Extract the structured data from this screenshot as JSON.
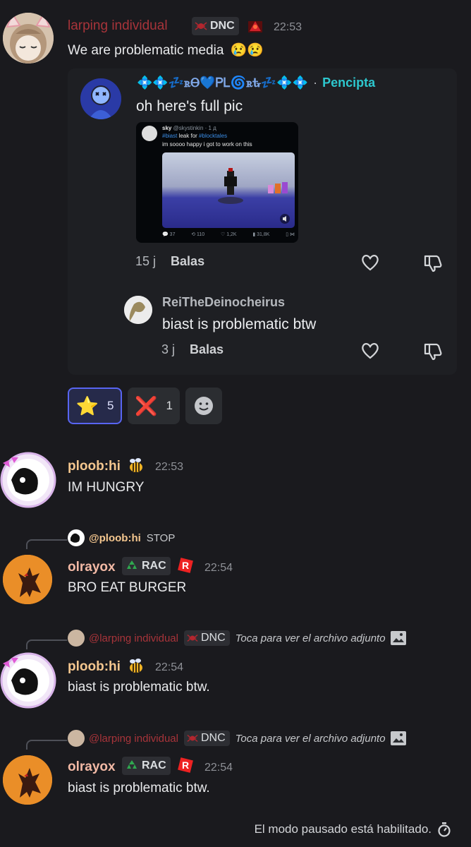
{
  "messages": [
    {
      "author": "larping individual",
      "tag": "DNC",
      "time": "22:53",
      "text": "We are problematic media",
      "emoji": "😢😢"
    },
    {
      "author": "ploob:hi",
      "time": "22:53",
      "text": "IM HUNGRY"
    },
    {
      "reply_to_name": "@ploob:hi",
      "reply_to_text": "STOP",
      "author": "olrayox",
      "tag": "RAC",
      "time": "22:54",
      "text": "BRO EAT BURGER"
    },
    {
      "reply_to_name": "@larping individual",
      "reply_to_tag": "DNC",
      "reply_to_text": "Toca para ver el archivo adjunto",
      "author": "ploob:hi",
      "time": "22:54",
      "text": "biast is problematic btw."
    },
    {
      "reply_to_name": "@larping individual",
      "reply_to_tag": "DNC",
      "reply_to_text": "Toca para ver el archivo adjunto",
      "author": "olrayox",
      "tag": "RAC",
      "time": "22:54",
      "text": "biast is problematic btw."
    }
  ],
  "forum": {
    "author": "💠💠💤ꭱᎾ💙ᏢᏞ🌀ꭱᎿ💤💠💠",
    "separator": "·",
    "platform": "Pencipta",
    "text": "oh here's full pic",
    "tweet": {
      "user": "sky",
      "handle": "@skystinkin · 1 д",
      "line1_hash1": "#biast",
      "line1_mid": " leak for ",
      "line1_hash2": "#blocktales",
      "line2": "im soooo happy i got to work on this",
      "stats": [
        "37",
        "110",
        "1,2K",
        "31,8K"
      ]
    },
    "age": "15 j",
    "reply_label": "Balas",
    "comment": {
      "author": "ReiTheDeinocheirus",
      "text": "biast is problematic btw",
      "age": "3 j",
      "reply_label": "Balas"
    }
  },
  "reactions": [
    {
      "emoji": "⭐",
      "count": "5",
      "active": true
    },
    {
      "emoji": "❌",
      "count": "1",
      "active": false
    }
  ],
  "footer": {
    "text": "El modo pausado está habilitado."
  },
  "colors": {
    "background": "#1a1a1e",
    "larping_name": "#a8343a",
    "ploob_name": "#f5c78f",
    "olrayox_name": "#f2b9a5",
    "pencipta": "#2dc7ce",
    "reaction_active_border": "#5865f2"
  }
}
